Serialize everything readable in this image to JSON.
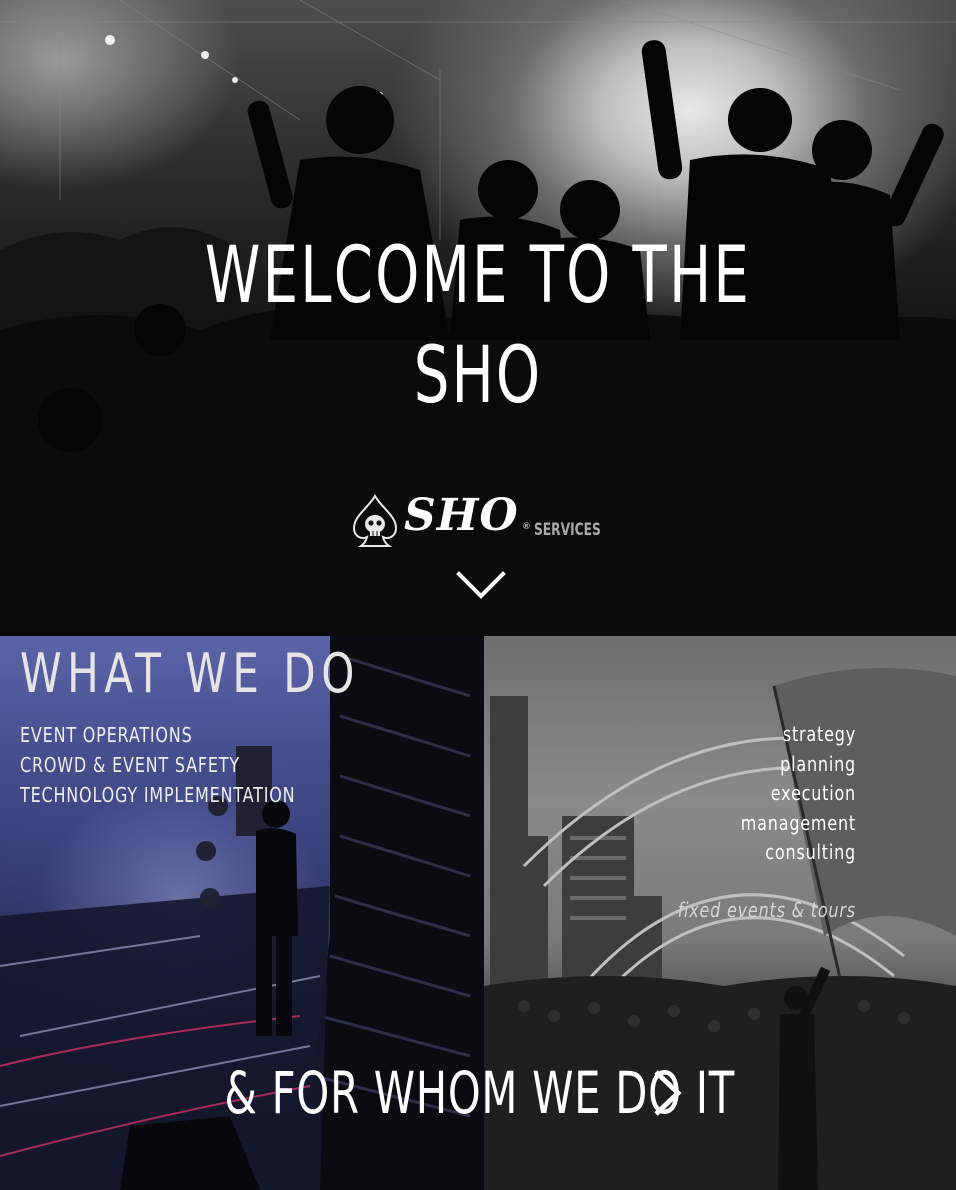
{
  "hero": {
    "title": "WELCOME TO THE SHO",
    "brand_name": "SHO",
    "brand_reg": "®",
    "brand_sub": "SERVICES",
    "brand_icon": "skull-ace-icon",
    "scroll_icon": "chevron-down-icon"
  },
  "what_we_do": {
    "title": "WHAT WE DO",
    "services": [
      "EVENT OPERATIONS",
      "CROWD & EVENT SAFETY",
      "TECHNOLOGY IMPLEMENTATION"
    ]
  },
  "approach": {
    "items": [
      "strategy",
      "planning",
      "execution",
      "management",
      "consulting"
    ],
    "note": "fixed events & tours"
  },
  "whom": {
    "title": "& FOR WHOM WE DO IT",
    "arrow_icon": "chevron-right-icon"
  },
  "colors": {
    "hero_bg": "#0a0a0a",
    "left_panel_tint": "#3a427c",
    "text": "#ffffff",
    "muted_text": "#a8a8a8"
  }
}
